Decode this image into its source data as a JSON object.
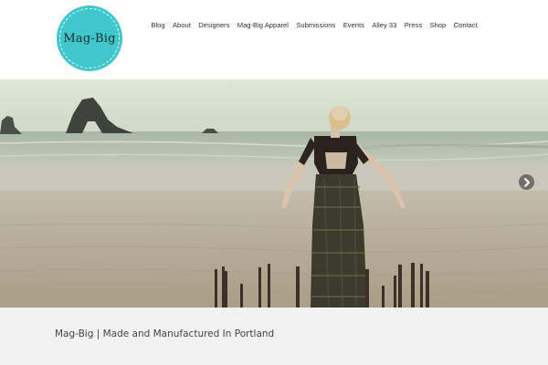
{
  "logo": {
    "text": "Mag-Big",
    "icon": "mag-big-logo"
  },
  "nav": {
    "items": [
      {
        "label": "Blog"
      },
      {
        "label": "About"
      },
      {
        "label": "Designers"
      },
      {
        "label": "Mag-Big Apparel"
      },
      {
        "label": "Submissions"
      },
      {
        "label": "Events"
      },
      {
        "label": "Alley 33"
      },
      {
        "label": "Press"
      },
      {
        "label": "Shop"
      },
      {
        "label": "Contact"
      }
    ]
  },
  "hero": {
    "description": "Woman standing on a beach with arms outstretched",
    "next_icon": "chevron-right-icon"
  },
  "footer": {
    "tagline": "Mag-Big | Made and Manufactured In Portland"
  },
  "colors": {
    "logo": "#3fc7cc",
    "footer_bg": "#f2f2f2",
    "sky": "#d9e2cf",
    "sand": "#b8b09b"
  }
}
